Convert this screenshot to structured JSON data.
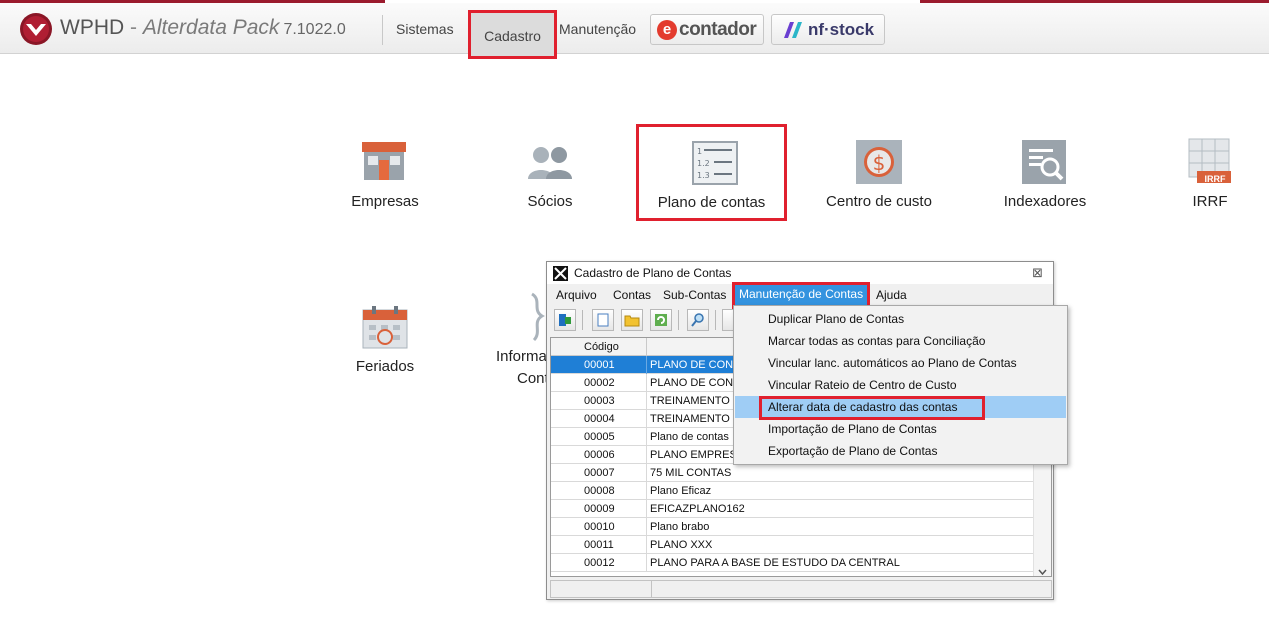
{
  "app": {
    "brand": "WPHD",
    "brand_dash": "-",
    "brand_sub": "Alterdata Pack",
    "version": "7.1022.0"
  },
  "nav": {
    "items": [
      "Sistemas",
      "Cadastro",
      "Manutenção"
    ],
    "active": "Cadastro",
    "contador_label": "contador",
    "contador_badge": "e",
    "nfstock_label": "nf·stock"
  },
  "tiles": {
    "empresas": "Empresas",
    "socios": "Sócios",
    "plano": "Plano de contas",
    "centro": "Centro de custo",
    "indexadores": "Indexadores",
    "irrf": "IRRF",
    "irrf_badge": "IRRF",
    "feriados": "Feriados",
    "informacoes_1": "Informa",
    "informacoes_2": "Cont"
  },
  "window": {
    "title": "Cadastro de Plano de Contas",
    "close": "⊠",
    "menu": [
      "Arquivo",
      "Contas",
      "Sub-Contas",
      "Manutenção de Contas",
      "Ajuda"
    ],
    "active_menu": "Manutenção de Contas",
    "grid": {
      "header_code": "Código",
      "rows": [
        {
          "code": "00001",
          "name": "PLANO DE CONT"
        },
        {
          "code": "00002",
          "name": "PLANO DE CONT"
        },
        {
          "code": "00003",
          "name": "TREINAMENTO"
        },
        {
          "code": "00004",
          "name": "TREINAMENTO"
        },
        {
          "code": "00005",
          "name": "Plano de contas"
        },
        {
          "code": "00006",
          "name": "PLANO EMPRES"
        },
        {
          "code": "00007",
          "name": "75 MIL CONTAS"
        },
        {
          "code": "00008",
          "name": "Plano Eficaz"
        },
        {
          "code": "00009",
          "name": "EFICAZPLANO162"
        },
        {
          "code": "00010",
          "name": "Plano brabo"
        },
        {
          "code": "00011",
          "name": "PLANO XXX"
        },
        {
          "code": "00012",
          "name": "PLANO PARA A BASE DE ESTUDO DA CENTRAL"
        }
      ],
      "selected_code": "00001"
    }
  },
  "dropdown": {
    "items": [
      "Duplicar Plano de Contas",
      "Marcar todas as contas para Conciliação",
      "Vincular lanc. automáticos ao Plano de Contas",
      "Vincular Rateio de Centro de Custo",
      "Alterar data de cadastro das contas",
      "Importação de Plano de Contas",
      "Exportação de Plano de Contas"
    ],
    "highlighted": "Alterar data de cadastro das contas"
  },
  "colors": {
    "accent_red": "#e0202e",
    "selection_blue": "#1f7fd6",
    "menu_blue": "#3393df",
    "hover_blue": "#9fcdf5"
  }
}
